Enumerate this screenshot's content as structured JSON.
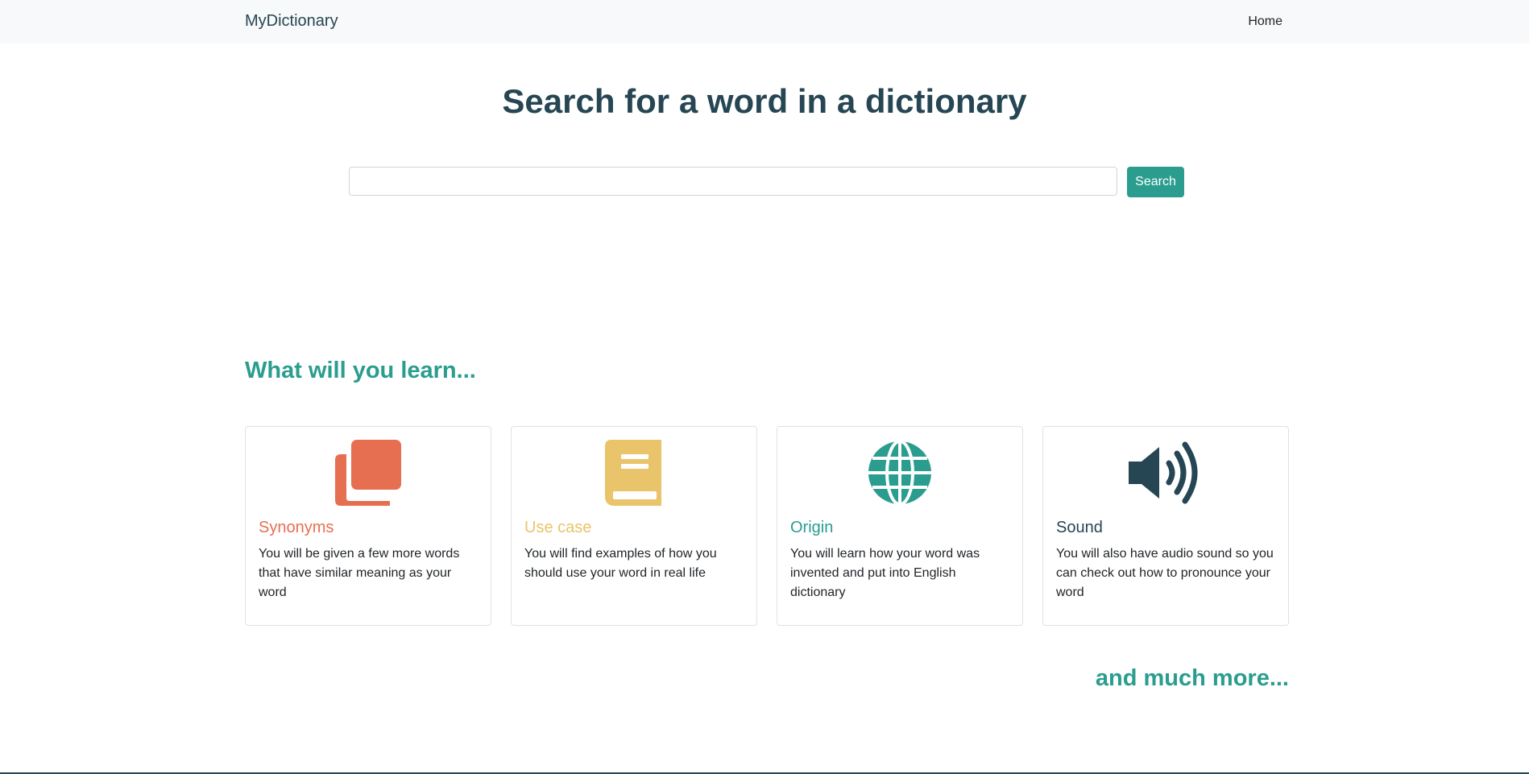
{
  "navbar": {
    "brand": "MyDictionary",
    "links": [
      "Home"
    ]
  },
  "hero": {
    "title": "Search for a word in a dictionary"
  },
  "search": {
    "value": "",
    "placeholder": "",
    "button_label": "Search"
  },
  "learn": {
    "title": "What will you learn...",
    "cards": [
      {
        "icon": "copy-icon",
        "title": "Synonyms",
        "text": "You will be given a few more words that have similar meaning as your word",
        "color": "#e76f51"
      },
      {
        "icon": "book-icon",
        "title": "Use case",
        "text": "You will find examples of how you should use your word in real life",
        "color": "#e9c46a"
      },
      {
        "icon": "globe-icon",
        "title": "Origin",
        "text": "You will learn how your word was invented and put into English dictionary",
        "color": "#2a9d8f"
      },
      {
        "icon": "volume-icon",
        "title": "Sound",
        "text": "You will also have audio sound so you can check out how to pronounce your word",
        "color": "#264653"
      }
    ],
    "more": "and much more..."
  },
  "colors": {
    "primary": "#2a9d8f",
    "dark": "#264653",
    "orange": "#e76f51",
    "yellow": "#e9c46a",
    "navbar_bg": "#f8f9fa"
  }
}
